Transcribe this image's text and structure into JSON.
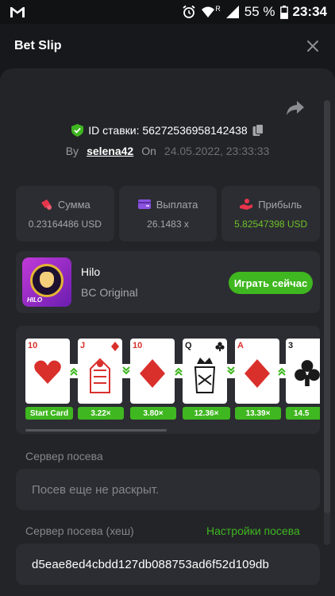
{
  "status_bar": {
    "battery": "55 %",
    "time": "23:34",
    "network": "R"
  },
  "header": {
    "title": "Bet Slip"
  },
  "bet": {
    "id_label": "ID ставки: 56272536958142438",
    "by_label": "By",
    "user": "selena42",
    "on_label": "On",
    "date": "24.05.2022, 23:33:33"
  },
  "stats": [
    {
      "label": "Сумма",
      "value": "0.23164486 USD",
      "icon": "wager-icon"
    },
    {
      "label": "Выплата",
      "value": "26.1483 x",
      "icon": "wallet-icon"
    },
    {
      "label": "Прибыль",
      "value": "5.82547398 USD",
      "icon": "profit-icon"
    }
  ],
  "game": {
    "name": "Hilo",
    "provider": "BC Original",
    "play_label": "Играть сейчас",
    "thumb_text": "HILO"
  },
  "cards": [
    {
      "rank": "10",
      "suit": "hearts",
      "color": "red",
      "multiplier": "Start Card",
      "arrow": ""
    },
    {
      "rank": "J",
      "suit": "diamonds",
      "color": "red",
      "multiplier": "3.22×",
      "arrow": "up"
    },
    {
      "rank": "10",
      "suit": "diamonds",
      "color": "red",
      "multiplier": "3.80×",
      "arrow": "down"
    },
    {
      "rank": "Q",
      "suit": "clubs",
      "color": "black",
      "multiplier": "12.36×",
      "arrow": "up"
    },
    {
      "rank": "A",
      "suit": "diamonds",
      "color": "red",
      "multiplier": "13.39×",
      "arrow": "down"
    },
    {
      "rank": "3",
      "suit": "clubs",
      "color": "black",
      "multiplier": "14.5",
      "arrow": "up"
    }
  ],
  "seed": {
    "server_label": "Сервер посева",
    "server_placeholder": "Посев еще не раскрыт.",
    "hash_label": "Сервер посева (хеш)",
    "settings_link": "Настройки посева",
    "hash_value": "d5eae8ed4cbdd127db088753ad6f52d109db"
  },
  "colors": {
    "accent_green": "#3fb720",
    "profit_green": "#6ec12a",
    "panel": "#232428",
    "card_bg": "#2c2d32"
  }
}
